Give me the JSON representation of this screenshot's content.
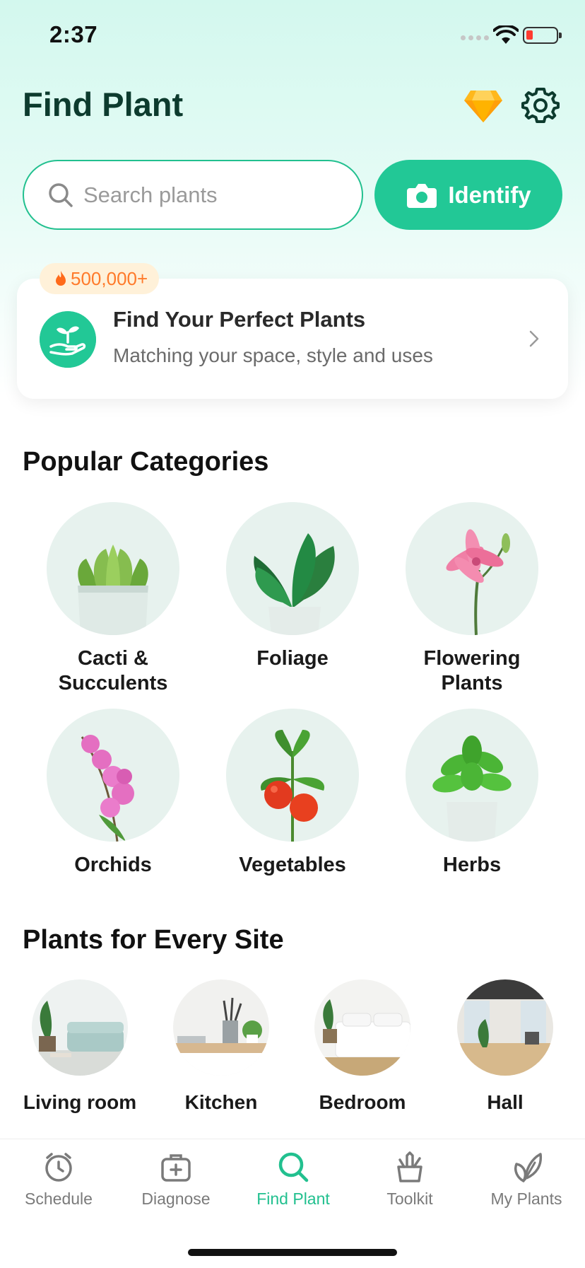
{
  "status_bar": {
    "time": "2:37"
  },
  "header": {
    "title": "Find Plant"
  },
  "search": {
    "placeholder": "Search plants"
  },
  "identify": {
    "label": "Identify"
  },
  "promo": {
    "badge": "500,000+",
    "title": "Find Your Perfect Plants",
    "subtitle": "Matching your space, style and uses"
  },
  "popular": {
    "heading": "Popular Categories",
    "items": [
      {
        "label": "Cacti & Succulents"
      },
      {
        "label": "Foliage"
      },
      {
        "label": "Flowering Plants"
      },
      {
        "label": "Orchids"
      },
      {
        "label": "Vegetables"
      },
      {
        "label": "Herbs"
      }
    ]
  },
  "sites": {
    "heading": "Plants for Every Site",
    "items": [
      {
        "label": "Living room"
      },
      {
        "label": "Kitchen"
      },
      {
        "label": "Bedroom"
      },
      {
        "label": "Hall"
      }
    ]
  },
  "tabbar": {
    "items": [
      {
        "label": "Schedule",
        "icon": "clock-icon"
      },
      {
        "label": "Diagnose",
        "icon": "medkit-icon"
      },
      {
        "label": "Find Plant",
        "icon": "search-icon",
        "active": true
      },
      {
        "label": "Toolkit",
        "icon": "toolkit-icon"
      },
      {
        "label": "My Plants",
        "icon": "leaves-icon"
      }
    ]
  },
  "colors": {
    "accent": "#22c896",
    "title": "#0d3b2e",
    "badge_text": "#ff7a2a",
    "badge_bg": "#fff1d9"
  }
}
